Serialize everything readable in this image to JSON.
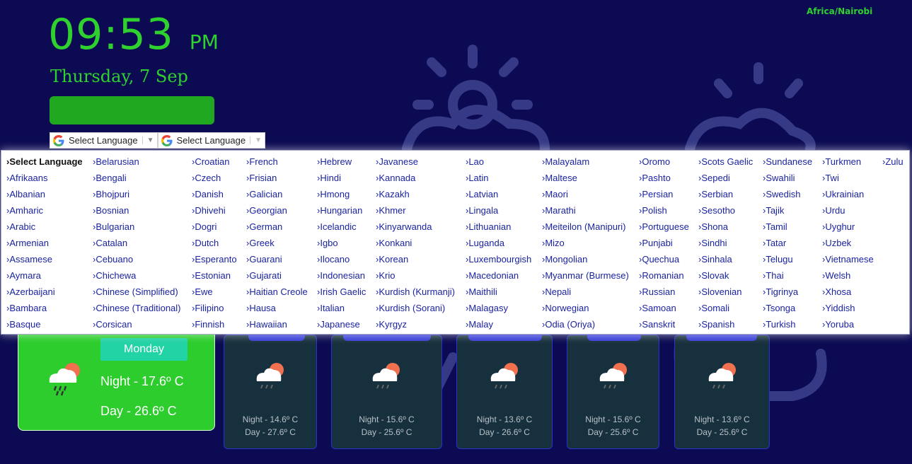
{
  "header": {
    "timezone": "Africa/Nairobi",
    "time": "09:53",
    "ampm": "PM",
    "date": "Thursday, 7 Sep"
  },
  "translate": {
    "select_label": "Select Language"
  },
  "languages": [
    [
      "›Select Language",
      "›Afrikaans",
      "›Albanian",
      "›Amharic",
      "›Arabic",
      "›Armenian",
      "›Assamese",
      "›Aymara",
      "›Azerbaijani",
      "›Bambara",
      "›Basque"
    ],
    [
      "›Belarusian",
      "›Bengali",
      "›Bhojpuri",
      "›Bosnian",
      "›Bulgarian",
      "›Catalan",
      "›Cebuano",
      "›Chichewa",
      "›Chinese (Simplified)",
      "›Chinese (Traditional)",
      "›Corsican"
    ],
    [
      "›Croatian",
      "›Czech",
      "›Danish",
      "›Dhivehi",
      "›Dogri",
      "›Dutch",
      "›Esperanto",
      "›Estonian",
      "›Ewe",
      "›Filipino",
      "›Finnish"
    ],
    [
      "›French",
      "›Frisian",
      "›Galician",
      "›Georgian",
      "›German",
      "›Greek",
      "›Guarani",
      "›Gujarati",
      "›Haitian Creole",
      "›Hausa",
      "›Hawaiian"
    ],
    [
      "›Hebrew",
      "›Hindi",
      "›Hmong",
      "›Hungarian",
      "›Icelandic",
      "›Igbo",
      "›Ilocano",
      "›Indonesian",
      "›Irish Gaelic",
      "›Italian",
      "›Japanese"
    ],
    [
      "›Javanese",
      "›Kannada",
      "›Kazakh",
      "›Khmer",
      "›Kinyarwanda",
      "›Konkani",
      "›Korean",
      "›Krio",
      "›Kurdish (Kurmanji)",
      "›Kurdish (Sorani)",
      "›Kyrgyz"
    ],
    [
      "›Lao",
      "›Latin",
      "›Latvian",
      "›Lingala",
      "›Lithuanian",
      "›Luganda",
      "›Luxembourgish",
      "›Macedonian",
      "›Maithili",
      "›Malagasy",
      "›Malay"
    ],
    [
      "›Malayalam",
      "›Maltese",
      "›Maori",
      "›Marathi",
      "›Meiteilon (Manipuri)",
      "›Mizo",
      "›Mongolian",
      "›Myanmar (Burmese)",
      "›Nepali",
      "›Norwegian",
      "›Odia (Oriya)"
    ],
    [
      "›Oromo",
      "›Pashto",
      "›Persian",
      "›Polish",
      "›Portuguese",
      "›Punjabi",
      "›Quechua",
      "›Romanian",
      "›Russian",
      "›Samoan",
      "›Sanskrit"
    ],
    [
      "›Scots Gaelic",
      "›Sepedi",
      "›Serbian",
      "›Sesotho",
      "›Shona",
      "›Sindhi",
      "›Sinhala",
      "›Slovak",
      "›Slovenian",
      "›Somali",
      "›Spanish"
    ],
    [
      "›Sundanese",
      "›Swahili",
      "›Swedish",
      "›Tajik",
      "›Tamil",
      "›Tatar",
      "›Telugu",
      "›Thai",
      "›Tigrinya",
      "›Tsonga",
      "›Turkish"
    ],
    [
      "›Turkmen",
      "›Twi",
      "›Ukrainian",
      "›Urdu",
      "›Uyghur",
      "›Uzbek",
      "›Vietnamese",
      "›Welsh",
      "›Xhosa",
      "›Yiddish",
      "›Yoruba"
    ],
    [
      "›Zulu"
    ]
  ],
  "today": {
    "day": "Monday",
    "night": "Night - 17.6º C",
    "daytemp": "Day - 26.6º C",
    "icon": "cloud-rain-sun-icon"
  },
  "forecast": [
    {
      "night": "Night - 14.6º C",
      "day": "Day - 27.6º C",
      "icon": "cloud-rain-sun-icon"
    },
    {
      "night": "Night - 15.6º C",
      "day": "Day - 25.6º C",
      "icon": "cloud-rain-sun-icon"
    },
    {
      "night": "Night - 13.6º C",
      "day": "Day - 26.6º C",
      "icon": "cloud-rain-sun-icon"
    },
    {
      "night": "Night - 15.6º C",
      "day": "Day - 25.6º C",
      "icon": "cloud-rain-sun-icon"
    },
    {
      "night": "Night - 13.6º C",
      "day": "Day - 25.6º C",
      "icon": "cloud-rain-sun-icon"
    }
  ],
  "colors": {
    "background": "#0b0a52",
    "accent_green": "#2fd12f",
    "today_card": "#2ccd2c",
    "forecast_card": "#17303d"
  }
}
